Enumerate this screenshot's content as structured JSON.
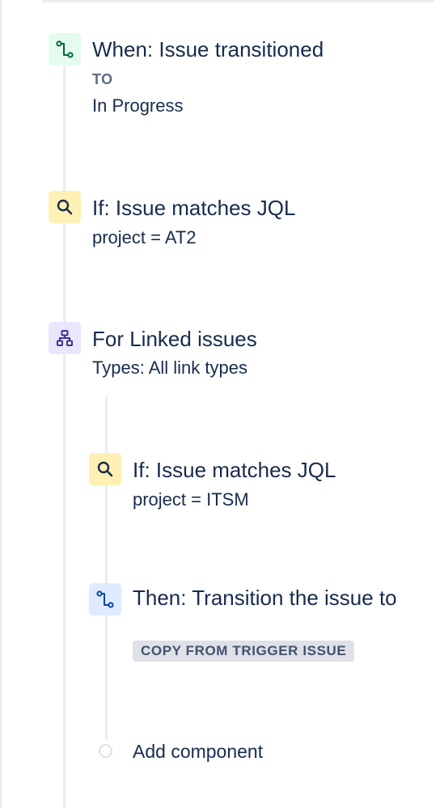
{
  "rule": {
    "trigger": {
      "title": "When: Issue transitioned",
      "to_label": "TO",
      "to_value": "In Progress",
      "icon": "transition-icon"
    },
    "condition_1": {
      "title": "If: Issue matches JQL",
      "query": "project = AT2",
      "icon": "search-icon"
    },
    "branch": {
      "title": "For Linked issues",
      "types": "Types: All link types",
      "icon": "branch-hierarchy-icon"
    },
    "nested_condition": {
      "title": "If: Issue matches JQL",
      "query": "project = ITSM",
      "icon": "search-icon"
    },
    "nested_action": {
      "title": "Then: Transition the issue to",
      "lozenge": "COPY FROM TRIGGER ISSUE",
      "icon": "transition-icon"
    },
    "add_component": {
      "label": "Add component"
    }
  },
  "colors": {
    "text": "#172B4D",
    "trigger_bg": "#E3FCEF",
    "trigger_fg": "#006644",
    "condition_bg": "#FFF0B3",
    "condition_fg": "#172B4D",
    "branch_bg": "#EAE6FF",
    "branch_fg": "#403294",
    "action_bg": "#DEEBFF",
    "action_fg": "#0747A6",
    "lozenge_bg": "#DFE1E6",
    "rail": "#EBECF0"
  }
}
